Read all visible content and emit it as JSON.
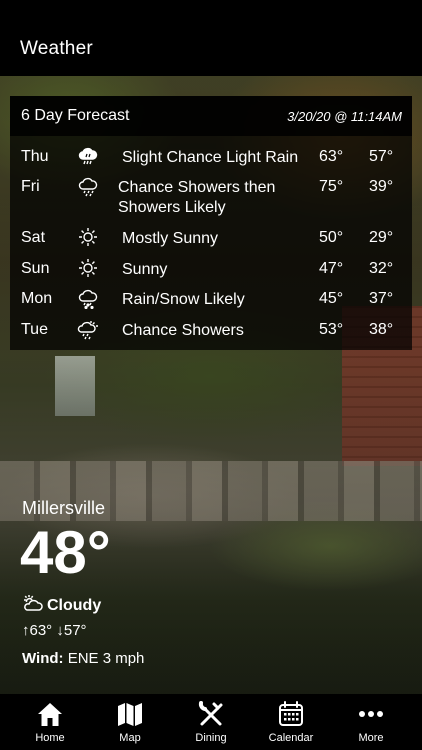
{
  "app": {
    "title": "Weather"
  },
  "forecast": {
    "title": "6 Day Forecast",
    "timestamp": "3/20/20 @ 11:14AM",
    "days": [
      {
        "day": "Thu",
        "icon": "rain-cloud-icon",
        "condition": "Slight Chance Light Rain",
        "high": "63°",
        "low": "57°"
      },
      {
        "day": "Fri",
        "icon": "showers-cloud-icon",
        "condition": "Chance Showers then Showers Likely",
        "high": "75°",
        "low": "39°"
      },
      {
        "day": "Sat",
        "icon": "sun-icon",
        "condition": "Mostly Sunny",
        "high": "50°",
        "low": "29°"
      },
      {
        "day": "Sun",
        "icon": "sun-icon",
        "condition": "Sunny",
        "high": "47°",
        "low": "32°"
      },
      {
        "day": "Mon",
        "icon": "rain-snow-cloud-icon",
        "condition": "Rain/Snow Likely",
        "high": "45°",
        "low": "37°"
      },
      {
        "day": "Tue",
        "icon": "sun-showers-icon",
        "condition": "Chance Showers",
        "high": "53°",
        "low": "38°"
      }
    ]
  },
  "current": {
    "city": "Millersville",
    "temperature": "48°",
    "condition": "Cloudy",
    "condition_icon": "partly-cloudy-icon",
    "high": "↑63°",
    "low": "↓57°",
    "wind_label": "Wind:",
    "wind_value": "ENE 3 mph"
  },
  "tabs": [
    {
      "label": "Home",
      "icon": "home-icon"
    },
    {
      "label": "Map",
      "icon": "map-icon"
    },
    {
      "label": "Dining",
      "icon": "dining-icon"
    },
    {
      "label": "Calendar",
      "icon": "calendar-icon"
    },
    {
      "label": "More",
      "icon": "more-icon"
    }
  ]
}
